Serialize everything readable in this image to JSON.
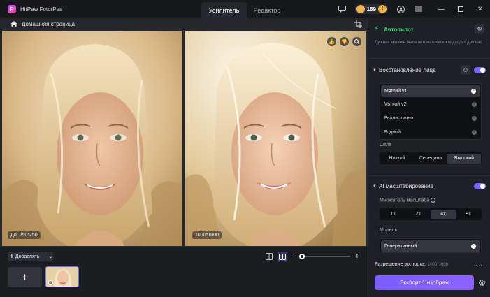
{
  "app": {
    "title": "HitPaw FotorPea"
  },
  "tabs": [
    {
      "label": "Усилитель",
      "active": true
    },
    {
      "label": "Редактор",
      "active": false
    }
  ],
  "titlebar": {
    "credits": "189"
  },
  "nav": {
    "home_label": "Домашняя страница"
  },
  "images": {
    "before_size": "До: 250*250",
    "after_size": "1000*1000"
  },
  "toolbar": {
    "add_label": "Добавлять"
  },
  "zoom": {
    "level": 0.05
  },
  "panel": {
    "autopilot": {
      "label": "Автопилот",
      "description": "Лучшая модель была автоматически подходит для вас"
    },
    "face": {
      "title": "Восстановление лица",
      "enabled": true,
      "models": [
        {
          "label": "Мягкий v1",
          "selected": true
        },
        {
          "label": "Мягкий v2",
          "selected": false
        },
        {
          "label": "Реалистично",
          "selected": false
        },
        {
          "label": "Родной",
          "selected": false
        }
      ],
      "strength_label": "Сила",
      "strength_options": [
        {
          "label": "Низкий",
          "selected": false
        },
        {
          "label": "Середина",
          "selected": false
        },
        {
          "label": "Высокий",
          "selected": true
        }
      ]
    },
    "upscale": {
      "title": "AI масштабирование",
      "enabled": true,
      "multiplier_label": "Множитель масштаба",
      "multipliers": [
        {
          "label": "1x",
          "selected": false
        },
        {
          "label": "2x",
          "selected": false
        },
        {
          "label": "4x",
          "selected": true
        },
        {
          "label": "8x",
          "selected": false
        }
      ],
      "model_label": "Модель",
      "models": [
        {
          "label": "Генеративный",
          "selected": true
        }
      ]
    },
    "export": {
      "resolution_label": "Разрешение экспорта:",
      "resolution_value": "1000*1000",
      "button_label": "Экспорт 1 изображ"
    }
  },
  "colors": {
    "accent": "#7b67ff",
    "autopilot": "#3ddc84"
  }
}
